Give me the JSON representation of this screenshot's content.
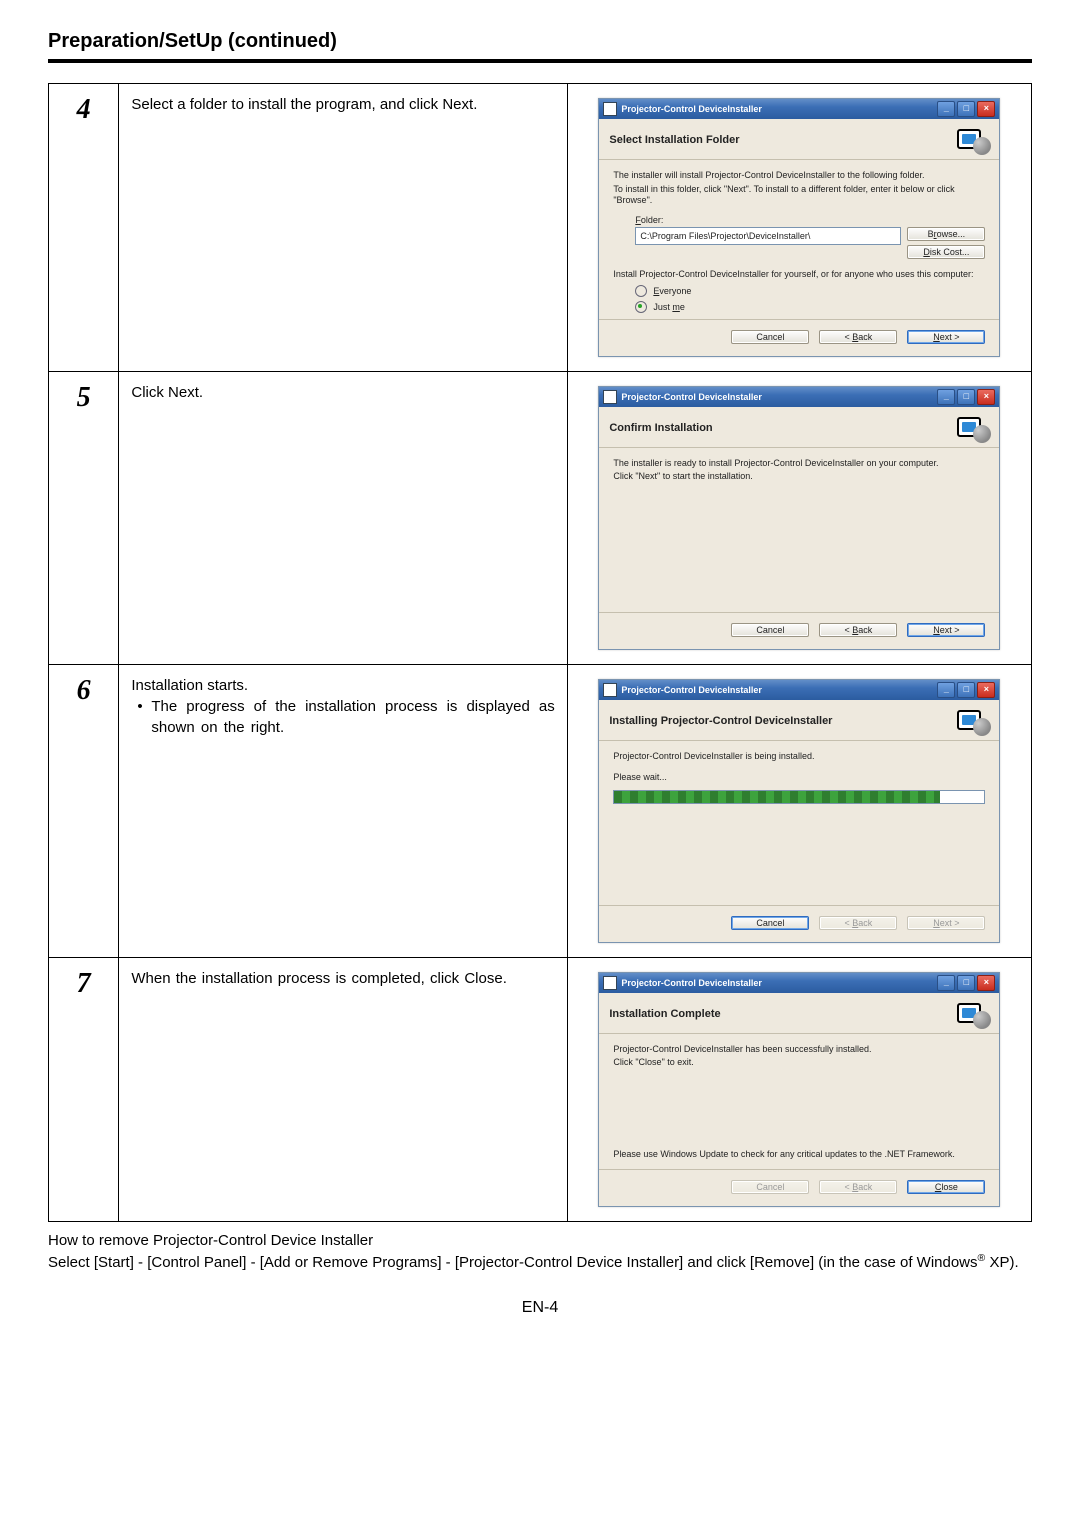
{
  "doc": {
    "section_title": "Preparation/SetUp (continued)",
    "page_number": "EN-4",
    "remove_heading": "How to remove Projector-Control Device Installer",
    "remove_body_a": "Select [Start] - [Control Panel] - [Add or Remove Programs] - [Projector-Control Device Installer] and click [Remove] (in the case of Windows",
    "remove_body_sup": "®",
    "remove_body_b": " XP)."
  },
  "steps": {
    "4": {
      "num": "4",
      "text": "Select a folder to install the program, and click Next."
    },
    "5": {
      "num": "5",
      "text": "Click Next."
    },
    "6": {
      "num": "6",
      "text1": "Installation starts.",
      "bullet": "The progress of the installation process is displayed as shown on the right."
    },
    "7": {
      "num": "7",
      "text": "When the installation process is completed, click Close."
    }
  },
  "win": {
    "title": "Projector-Control DeviceInstaller",
    "btn_min": "_",
    "btn_max": "□",
    "btn_close": "×",
    "btn_cancel": "Cancel",
    "btn_back": "< Back",
    "btn_next": "Next >",
    "btn_close_action": "Close",
    "btn_browse": "Browse...",
    "btn_diskcost": "Disk Cost...",
    "step4": {
      "heading": "Select Installation Folder",
      "line1": "The installer will install Projector-Control DeviceInstaller to the following folder.",
      "line2": "To install in this folder, click \"Next\". To install to a different folder, enter it below or click \"Browse\".",
      "folder_label": "Folder:",
      "folder_value": "C:\\Program Files\\Projector\\DeviceInstaller\\",
      "install_for": "Install Projector-Control DeviceInstaller for yourself, or for anyone who uses this computer:",
      "everyone": "Everyone",
      "justme": "Just me"
    },
    "step5": {
      "heading": "Confirm Installation",
      "line1": "The installer is ready to install Projector-Control DeviceInstaller on your computer.",
      "line2": "Click \"Next\" to start the installation."
    },
    "step6": {
      "heading": "Installing Projector-Control DeviceInstaller",
      "line1": "Projector-Control DeviceInstaller is being installed.",
      "wait": "Please wait..."
    },
    "step7": {
      "heading": "Installation Complete",
      "line1": "Projector-Control DeviceInstaller has been successfully installed.",
      "line2": "Click \"Close\" to exit.",
      "update": "Please use Windows Update to check for any critical updates to the .NET Framework."
    }
  }
}
